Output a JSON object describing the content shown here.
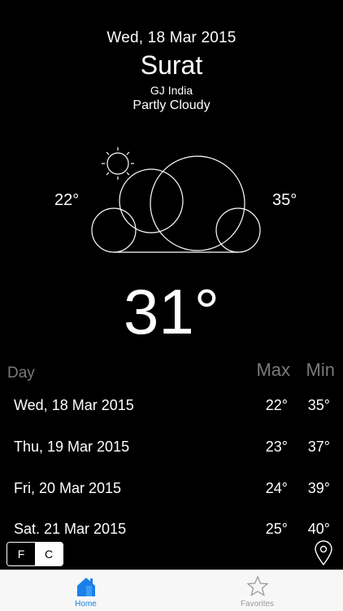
{
  "header": {
    "date": "Wed, 18 Mar 2015",
    "city": "Surat",
    "region": "GJ India",
    "condition": "Partly Cloudy"
  },
  "weather_art": {
    "icon": "partly-cloudy-icon",
    "low_temp": "22°",
    "high_temp": "35°"
  },
  "current": {
    "temperature": "31°"
  },
  "forecast": {
    "headers": {
      "day": "Day",
      "max": "Max",
      "min": "Min"
    },
    "rows": [
      {
        "day": "Wed, 18 Mar 2015",
        "max": "22°",
        "min": "35°"
      },
      {
        "day": "Thu, 19 Mar 2015",
        "max": "23°",
        "min": "37°"
      },
      {
        "day": "Fri, 20 Mar 2015",
        "max": "24°",
        "min": "39°"
      },
      {
        "day": "Sat. 21 Mar 2015",
        "max": "25°",
        "min": "40°"
      }
    ]
  },
  "unit_toggle": {
    "f_label": "F",
    "c_label": "C",
    "selected": "F"
  },
  "location_button": {
    "icon": "location-pin-icon"
  },
  "tabbar": {
    "tabs": [
      {
        "label": "Home",
        "icon": "home-icon",
        "active": true
      },
      {
        "label": "Favorites",
        "icon": "star-icon",
        "active": false
      }
    ]
  },
  "colors": {
    "background": "#000000",
    "text": "#ffffff",
    "header_muted": "#7a7a7a",
    "tab_active": "#1a7fe8",
    "tab_inactive": "#9a9a9a",
    "tabbar_bg": "#f7f7f7"
  }
}
